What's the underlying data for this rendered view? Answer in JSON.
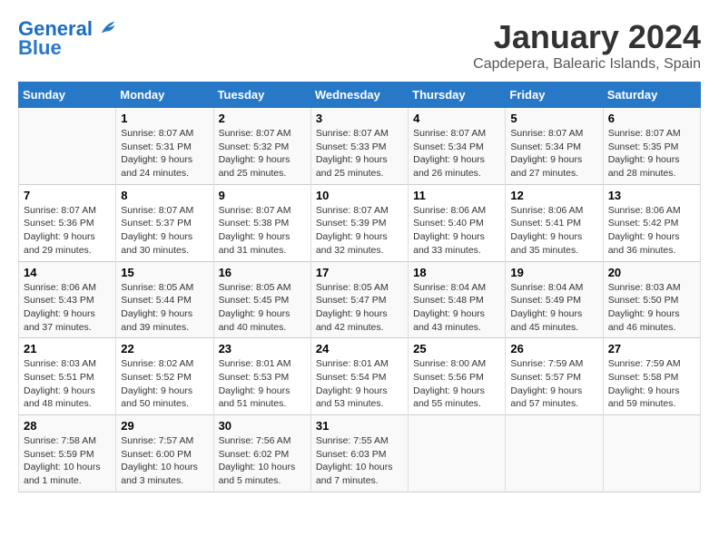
{
  "header": {
    "logo_line1": "General",
    "logo_line2": "Blue",
    "title": "January 2024",
    "subtitle": "Capdepera, Balearic Islands, Spain"
  },
  "days_of_week": [
    "Sunday",
    "Monday",
    "Tuesday",
    "Wednesday",
    "Thursday",
    "Friday",
    "Saturday"
  ],
  "weeks": [
    [
      {
        "day": "",
        "info": ""
      },
      {
        "day": "1",
        "info": "Sunrise: 8:07 AM\nSunset: 5:31 PM\nDaylight: 9 hours\nand 24 minutes."
      },
      {
        "day": "2",
        "info": "Sunrise: 8:07 AM\nSunset: 5:32 PM\nDaylight: 9 hours\nand 25 minutes."
      },
      {
        "day": "3",
        "info": "Sunrise: 8:07 AM\nSunset: 5:33 PM\nDaylight: 9 hours\nand 25 minutes."
      },
      {
        "day": "4",
        "info": "Sunrise: 8:07 AM\nSunset: 5:34 PM\nDaylight: 9 hours\nand 26 minutes."
      },
      {
        "day": "5",
        "info": "Sunrise: 8:07 AM\nSunset: 5:34 PM\nDaylight: 9 hours\nand 27 minutes."
      },
      {
        "day": "6",
        "info": "Sunrise: 8:07 AM\nSunset: 5:35 PM\nDaylight: 9 hours\nand 28 minutes."
      }
    ],
    [
      {
        "day": "7",
        "info": "Sunrise: 8:07 AM\nSunset: 5:36 PM\nDaylight: 9 hours\nand 29 minutes."
      },
      {
        "day": "8",
        "info": "Sunrise: 8:07 AM\nSunset: 5:37 PM\nDaylight: 9 hours\nand 30 minutes."
      },
      {
        "day": "9",
        "info": "Sunrise: 8:07 AM\nSunset: 5:38 PM\nDaylight: 9 hours\nand 31 minutes."
      },
      {
        "day": "10",
        "info": "Sunrise: 8:07 AM\nSunset: 5:39 PM\nDaylight: 9 hours\nand 32 minutes."
      },
      {
        "day": "11",
        "info": "Sunrise: 8:06 AM\nSunset: 5:40 PM\nDaylight: 9 hours\nand 33 minutes."
      },
      {
        "day": "12",
        "info": "Sunrise: 8:06 AM\nSunset: 5:41 PM\nDaylight: 9 hours\nand 35 minutes."
      },
      {
        "day": "13",
        "info": "Sunrise: 8:06 AM\nSunset: 5:42 PM\nDaylight: 9 hours\nand 36 minutes."
      }
    ],
    [
      {
        "day": "14",
        "info": "Sunrise: 8:06 AM\nSunset: 5:43 PM\nDaylight: 9 hours\nand 37 minutes."
      },
      {
        "day": "15",
        "info": "Sunrise: 8:05 AM\nSunset: 5:44 PM\nDaylight: 9 hours\nand 39 minutes."
      },
      {
        "day": "16",
        "info": "Sunrise: 8:05 AM\nSunset: 5:45 PM\nDaylight: 9 hours\nand 40 minutes."
      },
      {
        "day": "17",
        "info": "Sunrise: 8:05 AM\nSunset: 5:47 PM\nDaylight: 9 hours\nand 42 minutes."
      },
      {
        "day": "18",
        "info": "Sunrise: 8:04 AM\nSunset: 5:48 PM\nDaylight: 9 hours\nand 43 minutes."
      },
      {
        "day": "19",
        "info": "Sunrise: 8:04 AM\nSunset: 5:49 PM\nDaylight: 9 hours\nand 45 minutes."
      },
      {
        "day": "20",
        "info": "Sunrise: 8:03 AM\nSunset: 5:50 PM\nDaylight: 9 hours\nand 46 minutes."
      }
    ],
    [
      {
        "day": "21",
        "info": "Sunrise: 8:03 AM\nSunset: 5:51 PM\nDaylight: 9 hours\nand 48 minutes."
      },
      {
        "day": "22",
        "info": "Sunrise: 8:02 AM\nSunset: 5:52 PM\nDaylight: 9 hours\nand 50 minutes."
      },
      {
        "day": "23",
        "info": "Sunrise: 8:01 AM\nSunset: 5:53 PM\nDaylight: 9 hours\nand 51 minutes."
      },
      {
        "day": "24",
        "info": "Sunrise: 8:01 AM\nSunset: 5:54 PM\nDaylight: 9 hours\nand 53 minutes."
      },
      {
        "day": "25",
        "info": "Sunrise: 8:00 AM\nSunset: 5:56 PM\nDaylight: 9 hours\nand 55 minutes."
      },
      {
        "day": "26",
        "info": "Sunrise: 7:59 AM\nSunset: 5:57 PM\nDaylight: 9 hours\nand 57 minutes."
      },
      {
        "day": "27",
        "info": "Sunrise: 7:59 AM\nSunset: 5:58 PM\nDaylight: 9 hours\nand 59 minutes."
      }
    ],
    [
      {
        "day": "28",
        "info": "Sunrise: 7:58 AM\nSunset: 5:59 PM\nDaylight: 10 hours\nand 1 minute."
      },
      {
        "day": "29",
        "info": "Sunrise: 7:57 AM\nSunset: 6:00 PM\nDaylight: 10 hours\nand 3 minutes."
      },
      {
        "day": "30",
        "info": "Sunrise: 7:56 AM\nSunset: 6:02 PM\nDaylight: 10 hours\nand 5 minutes."
      },
      {
        "day": "31",
        "info": "Sunrise: 7:55 AM\nSunset: 6:03 PM\nDaylight: 10 hours\nand 7 minutes."
      },
      {
        "day": "",
        "info": ""
      },
      {
        "day": "",
        "info": ""
      },
      {
        "day": "",
        "info": ""
      }
    ]
  ]
}
